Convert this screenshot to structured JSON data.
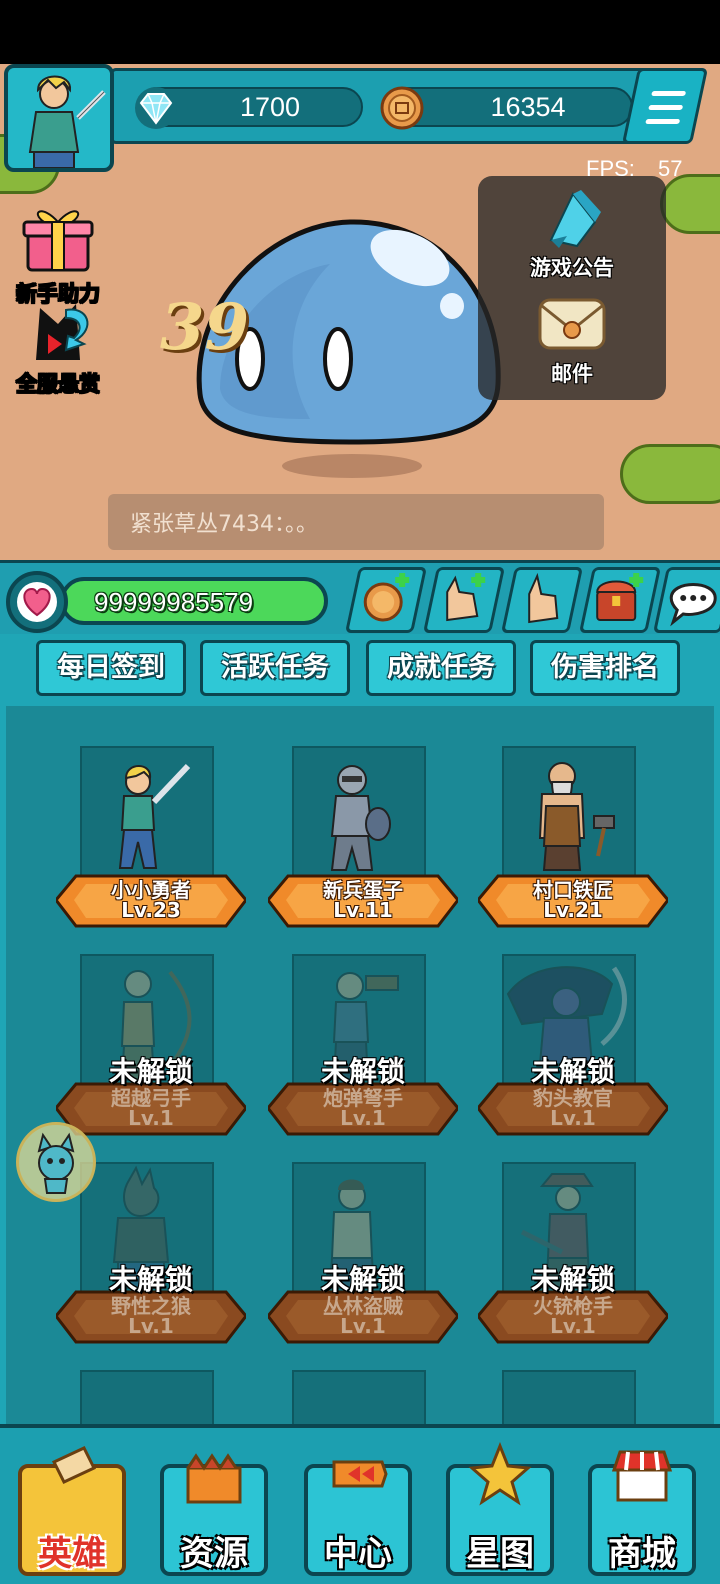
{
  "currency": {
    "gems": "1700",
    "coins": "16354"
  },
  "fps": {
    "label": "FPS:",
    "value": "57"
  },
  "side_buttons": [
    {
      "label": "新手助力",
      "icon": "gift-icon"
    },
    {
      "label": "全服悬赏",
      "icon": "bounty-icon"
    }
  ],
  "notice_panel": [
    {
      "label": "游戏公告",
      "icon": "announcement-icon"
    },
    {
      "label": "邮件",
      "icon": "mail-icon"
    }
  ],
  "damage_number": "39",
  "chat": {
    "message": "紧张草丛7434：。。"
  },
  "player": {
    "hp": "99999985579"
  },
  "action_buttons": [
    {
      "icon": "add-coins-icon"
    },
    {
      "icon": "add-tap-power-icon"
    },
    {
      "icon": "tap-icon"
    },
    {
      "icon": "add-chest-icon"
    },
    {
      "icon": "chat-bubble-icon"
    }
  ],
  "tabs": [
    "每日签到",
    "活跃任务",
    "成就任务",
    "伤害排名"
  ],
  "lock_label": "未解锁",
  "heroes": [
    {
      "name": "小小勇者",
      "level": "Lv.23",
      "locked": false
    },
    {
      "name": "新兵蛋子",
      "level": "Lv.11",
      "locked": false
    },
    {
      "name": "村口铁匠",
      "level": "Lv.21",
      "locked": false
    },
    {
      "name": "超越弓手",
      "level": "Lv.1",
      "locked": true
    },
    {
      "name": "炮弹弩手",
      "level": "Lv.1",
      "locked": true
    },
    {
      "name": "豹头教官",
      "level": "Lv.1",
      "locked": true
    },
    {
      "name": "野性之狼",
      "level": "Lv.1",
      "locked": true
    },
    {
      "name": "丛林盗贼",
      "level": "Lv.1",
      "locked": true
    },
    {
      "name": "火铳枪手",
      "level": "Lv.1",
      "locked": true
    }
  ],
  "bottom_nav": [
    {
      "label": "英雄",
      "active": true
    },
    {
      "label": "资源",
      "active": false
    },
    {
      "label": "中心",
      "active": false
    },
    {
      "label": "星图",
      "active": false
    },
    {
      "label": "商城",
      "active": false
    }
  ],
  "colors": {
    "panel": "#1c9fb0",
    "border": "#0b4650",
    "ground": "#e0a982",
    "hp_green": "#4cd85a",
    "nav_active": "#f4c43a"
  }
}
